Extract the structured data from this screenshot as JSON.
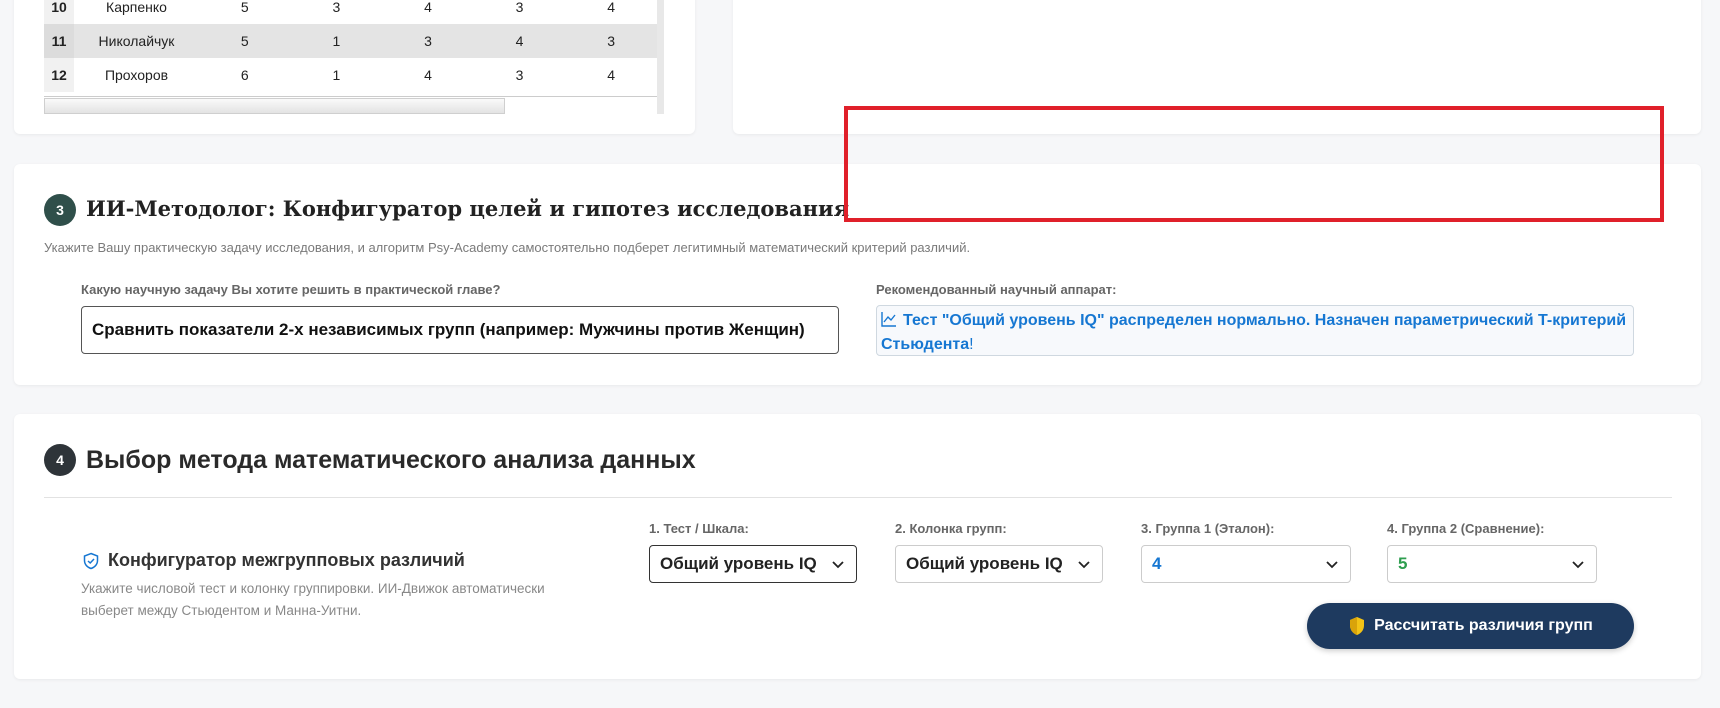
{
  "table": {
    "rows": [
      {
        "num": "10",
        "name": "Карпенко",
        "cells": [
          "5",
          "3",
          "4",
          "3",
          "4"
        ]
      },
      {
        "num": "11",
        "name": "Николайчук",
        "cells": [
          "5",
          "1",
          "3",
          "4",
          "3"
        ]
      },
      {
        "num": "12",
        "name": "Прохоров",
        "cells": [
          "6",
          "1",
          "4",
          "3",
          "4"
        ]
      }
    ]
  },
  "section3": {
    "step": "3",
    "title": "ИИ-Методолог: Конфигуратор целей и гипотез исследования",
    "description": "Укажите Вашу практическую задачу исследования, и алгоритм Psy-Academy самостоятельно подберет легитимный математический критерий различий.",
    "goal_label": "Какую научную задачу Вы хотите решить в практической главе?",
    "goal_value": "Сравнить показатели 2-х независимых групп (например: Мужчины против Женщин)",
    "rec_label": "Рекомендованный научный аппарат:",
    "rec_text": "Тест \"Общий уровень IQ\" распределен нормально. Назначен параметрический T-критерий Стьюдента",
    "rec_end": "!"
  },
  "section4": {
    "step": "4",
    "title": "Выбор метода математического анализа данных",
    "config_title": "Конфигуратор межгрупповых различий",
    "config_desc": "Укажите числовой тест и колонку группировки. ИИ-Движок автоматически выберет между Стьюдентом и Манна-Уитни.",
    "selects": [
      {
        "label": "1. Тест / Шкала:",
        "value": "Общий уровень IQ"
      },
      {
        "label": "2. Колонка групп:",
        "value": "Общий уровень IQ"
      },
      {
        "label": "3. Группа 1 (Эталон):",
        "value": "4",
        "color": "#1677d2"
      },
      {
        "label": "4. Группа 2 (Сравнение):",
        "value": "5",
        "color": "#2e9e4f"
      }
    ],
    "calc_button": "Рассчитать различия групп"
  },
  "colors": {
    "accent": "#1e3a5f",
    "highlight": "#e0202a",
    "link": "#1677d2"
  },
  "icons": [
    "chart-line-icon",
    "shield-check-icon",
    "shield-icon",
    "chevron-down-icon"
  ]
}
